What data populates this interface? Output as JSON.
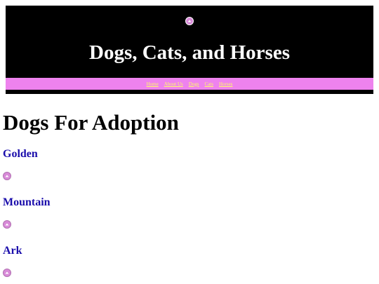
{
  "header": {
    "logo_icon": "broken-image-icon",
    "title": "Dogs, Cats, and Horses",
    "nav": [
      "Home",
      "About Us",
      "Dogs",
      "Cats",
      "Horses"
    ]
  },
  "main": {
    "title": "Dogs For Adoption",
    "dogs": [
      {
        "name": "Golden",
        "image_icon": "broken-image-icon"
      },
      {
        "name": "Mountain",
        "image_icon": "broken-image-icon"
      },
      {
        "name": "Ark",
        "image_icon": "broken-image-icon"
      }
    ]
  },
  "colors": {
    "header_bg": "#000000",
    "nav_bg": "#ee82ee",
    "nav_link": "#ffff66",
    "heading_link": "#1a0dab"
  }
}
